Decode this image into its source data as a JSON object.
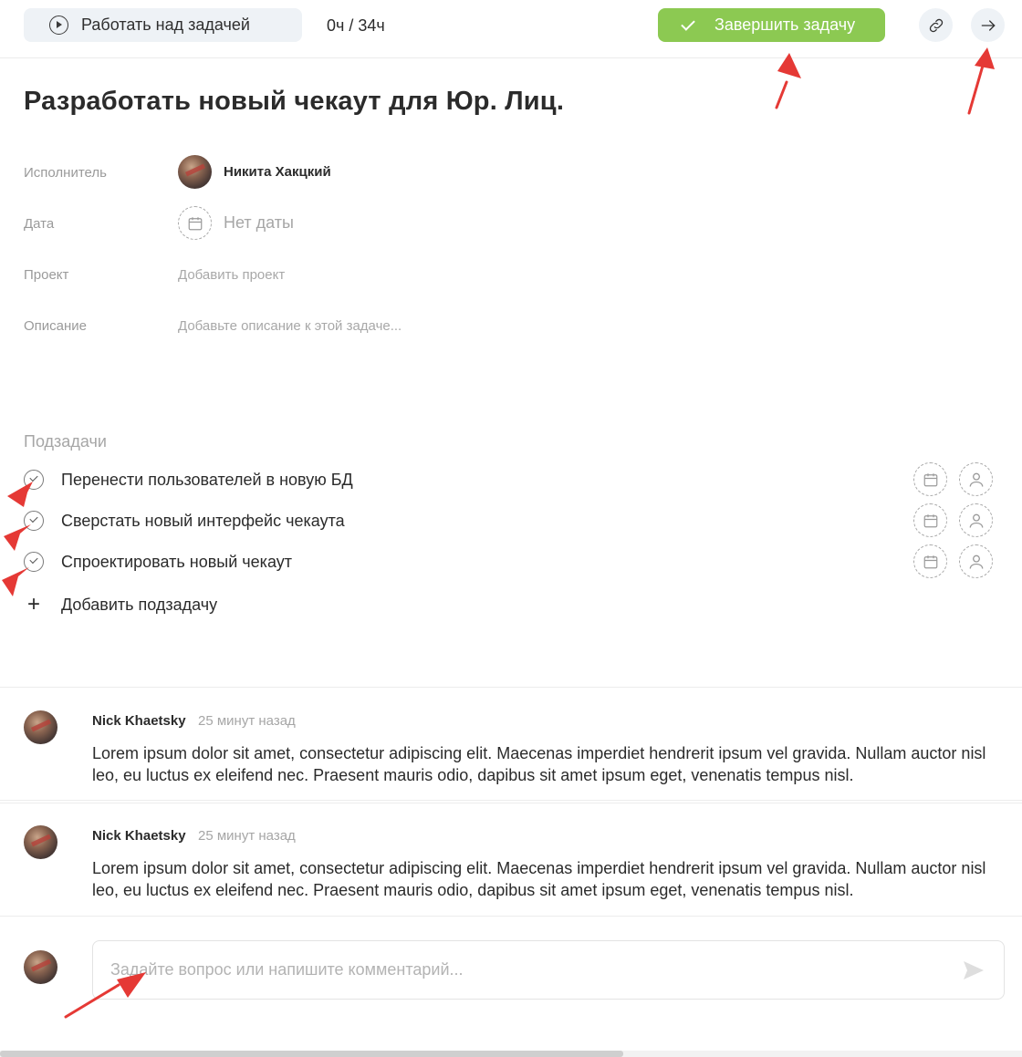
{
  "toolbar": {
    "work_label": "Работать над задачей",
    "timer": "0ч / 34ч",
    "complete_label": "Завершить задачу",
    "link_icon": "link-icon",
    "next_icon": "arrow-right-icon"
  },
  "task": {
    "title": "Разработать новый чекаут для Юр. Лиц."
  },
  "props": {
    "assignee_label": "Исполнитель",
    "assignee_name": "Никита Хакцкий",
    "date_label": "Дата",
    "date_value": "Нет даты",
    "project_label": "Проект",
    "project_value": "Добавить проект",
    "description_label": "Описание",
    "description_value": "Добавьте описание к этой задаче..."
  },
  "subtasks": {
    "title": "Подзадачи",
    "items": [
      {
        "label": "Перенести пользователей в новую БД"
      },
      {
        "label": "Сверстать новый интерфейс чекаута"
      },
      {
        "label": "Спроектировать новый чекаут"
      }
    ],
    "add_label": "Добавить подзадачу"
  },
  "comments": [
    {
      "author": "Nick Khaetsky",
      "time": "25 минут назад",
      "text": "Lorem ipsum dolor sit amet, consectetur adipiscing elit. Maecenas imperdiet hendrerit ipsum vel gravida. Nullam auctor nisl leo, eu luctus ex eleifend nec. Praesent mauris odio, dapibus sit amet ipsum eget, venenatis tempus nisl."
    },
    {
      "author": "Nick Khaetsky",
      "time": "25 минут назад",
      "text": "Lorem ipsum dolor sit amet, consectetur adipiscing elit. Maecenas imperdiet hendrerit ipsum vel gravida. Nullam auctor nisl leo, eu luctus ex eleifend nec. Praesent mauris odio, dapibus sit amet ipsum eget, venenatis tempus nisl."
    }
  ],
  "composer": {
    "placeholder": "Задайте вопрос или напишите комментарий..."
  },
  "colors": {
    "accent_green": "#8cc952",
    "annotation_red": "#e53935",
    "button_bg": "#eef2f6"
  },
  "scrollbar": {
    "position_fraction": 0.61
  }
}
